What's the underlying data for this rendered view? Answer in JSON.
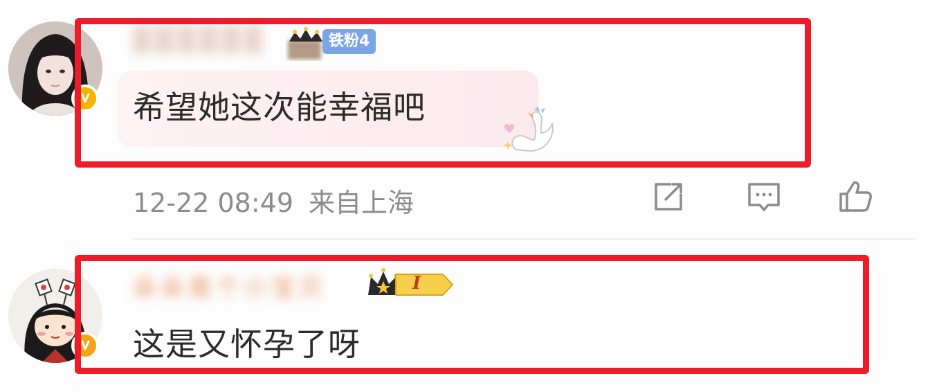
{
  "comments": [
    {
      "author_name": "██████",
      "fan_badge": "铁粉4",
      "text": "希望她这次能幸福吧",
      "timestamp": "12-22 08:49",
      "location": "来自上海",
      "avatar_icon": "avatar-girl-photo",
      "verified_icon": "verified-v-icon"
    },
    {
      "author_name": "朵朵是个小宝贝",
      "level_badge": "I",
      "text": "这是又怀孕了呀",
      "avatar_icon": "avatar-cartoon-girl",
      "verified_icon": "verified-v-icon"
    }
  ],
  "actions": {
    "repost_icon": "repost-icon",
    "comment_icon": "comment-icon",
    "like_icon": "thumbs-up-icon"
  },
  "colors": {
    "highlight": "#ee1c2b",
    "fan_badge_bg": "#7aa6e8",
    "verified_badge": "#f4b400",
    "meta_text": "#8c8c8c",
    "body_text": "#2b2b2b"
  }
}
